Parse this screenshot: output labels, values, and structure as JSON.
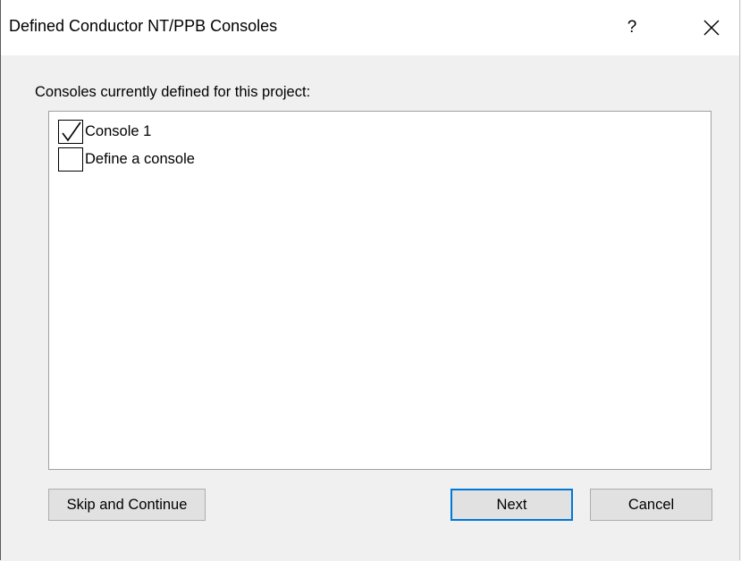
{
  "window": {
    "title": "Defined Conductor NT/PPB Consoles",
    "help_label": "?",
    "close_icon": "close-icon"
  },
  "prompt": "Consoles currently defined for this project:",
  "consoles": [
    {
      "label": "Console 1",
      "checked": true
    },
    {
      "label": "Define a console",
      "checked": false
    }
  ],
  "buttons": {
    "skip": "Skip and Continue",
    "next": "Next",
    "cancel": "Cancel"
  },
  "colors": {
    "default_button_border": "#0078d7",
    "button_face": "#e1e1e1",
    "dialog_bg": "#f0f0f0"
  }
}
